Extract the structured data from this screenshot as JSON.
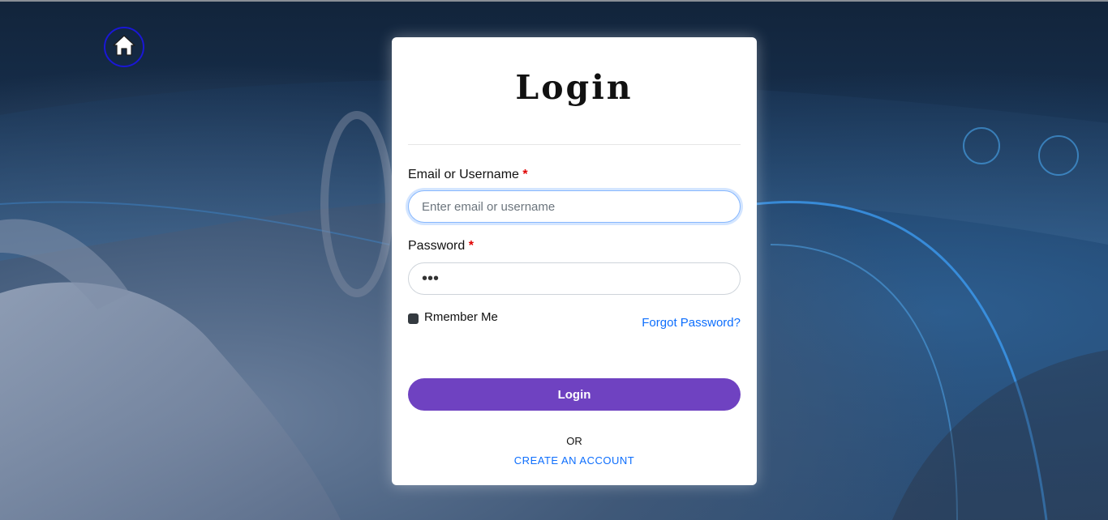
{
  "page": {
    "title": "Login"
  },
  "form": {
    "email_label": "Email or Username",
    "email_required": "*",
    "email_placeholder": "Enter email or username",
    "email_value": "",
    "password_label": "Password",
    "password_required": "*",
    "password_value": "•••",
    "remember_label": "Rmember Me",
    "remember_checked": true,
    "forgot_link": "Forgot Password?",
    "submit_label": "Login",
    "or_text": "OR",
    "create_account_link": "CREATE AN ACCOUNT"
  },
  "icons": {
    "home": "home-icon"
  },
  "colors": {
    "primary_button": "#6f42c1",
    "link": "#0d6efd",
    "required": "#e00000",
    "home_ring": "#1a17d6"
  }
}
